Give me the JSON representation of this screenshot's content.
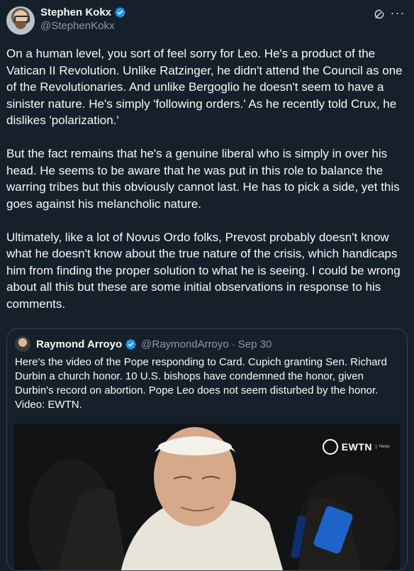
{
  "post": {
    "author_name": "Stephen Kokx",
    "author_handle": "@StephenKokx",
    "paragraphs": [
      "On a human level, you sort of feel sorry for Leo. He's a product of the Vatican II Revolution. Unlike Ratzinger, he didn't attend the Council as one of the Revolutionaries. And unlike Bergoglio he doesn't seem to have a sinister nature. He's simply 'following orders.' As he recently told Crux, he dislikes 'polarization.'",
      "But the fact remains that he's a genuine liberal who is simply in over his head. He seems to be aware that he was put in this role to balance the warring tribes but this obviously cannot last. He has to pick a side, yet this goes against his melancholic nature.",
      "Ultimately, like a lot of Novus Ordo folks, Prevost probably doesn't know what he doesn't know about the true nature of the crisis, which handicaps him from finding the proper solution to what he is seeing. I could be wrong about all this but these are some initial observations in response to his comments."
    ]
  },
  "quoted": {
    "author_name": "Raymond Arroyo",
    "author_handle": "@RaymondArroyo",
    "separator": "·",
    "date": "Sep 30",
    "text": "Here's the video of the Pope responding to Card. Cupich granting Sen. Richard Durbin a church honor. 10 U.S. bishops have condemned the honor, given Durbin's record on abortion. Pope Leo does not seem disturbed by the honor. Video: EWTN.",
    "media": {
      "logo_text": "EWTN",
      "logo_sub": "News"
    }
  },
  "colors": {
    "background": "#15202b",
    "verified": "#1d9bf0",
    "secondary_text": "#8b98a5"
  },
  "icons": {
    "verified": "verified-badge-icon",
    "grok": "grok-icon",
    "more": "more-icon"
  }
}
